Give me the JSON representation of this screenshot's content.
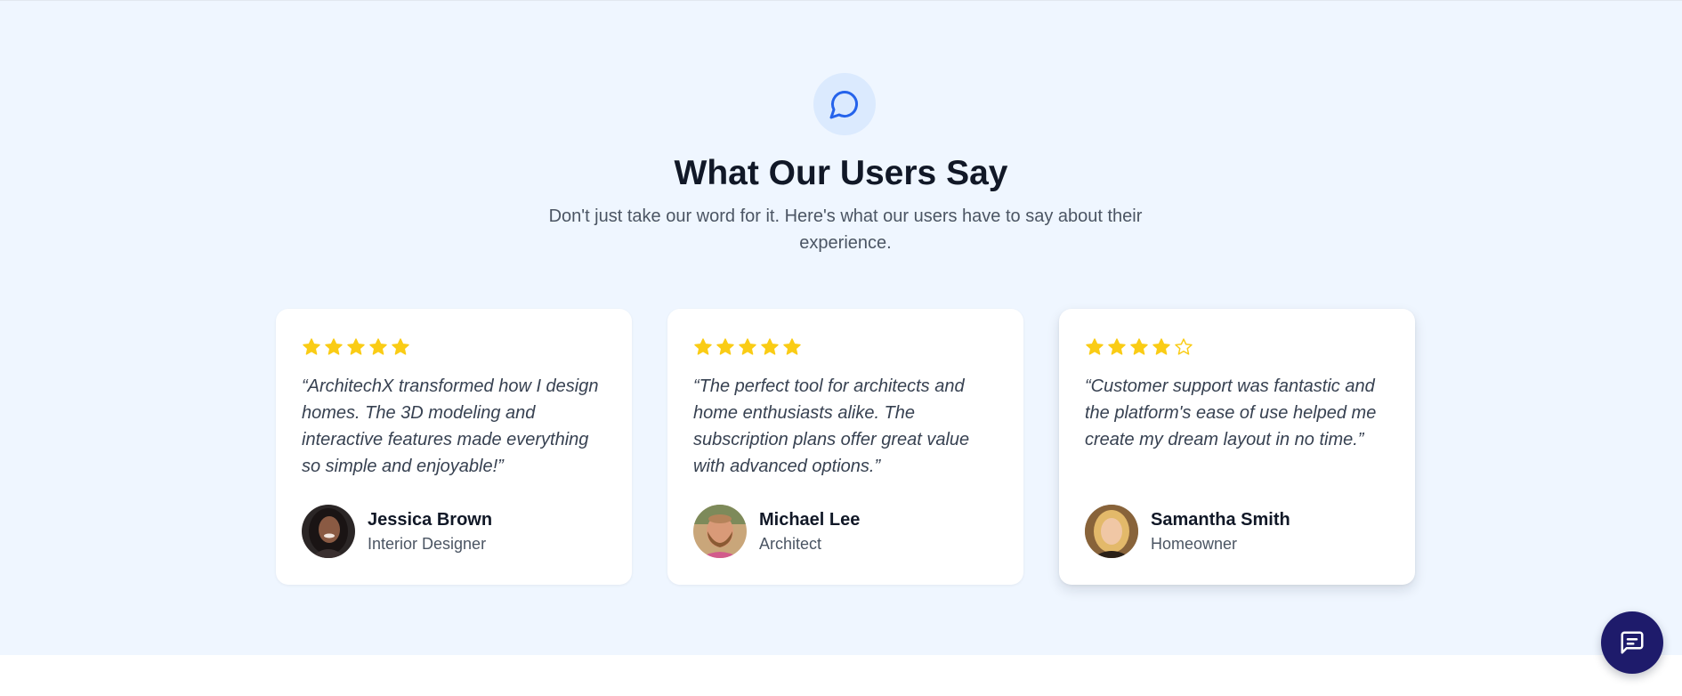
{
  "header": {
    "icon": "chat-bubble-icon",
    "title": "What Our Users Say",
    "subtitle": "Don't just take our word for it. Here's what our users have to say about their experience."
  },
  "colors": {
    "section_bg": "#eff6ff",
    "icon_circle_bg": "#dbeafe",
    "icon_stroke": "#2563eb",
    "star_fill": "#facc15",
    "fab_bg": "#1e1b6b"
  },
  "testimonials": [
    {
      "rating": 5,
      "quote": "“ArchitechX transformed how I design homes. The 3D modeling and interactive features made everything so simple and enjoyable!”",
      "name": "Jessica Brown",
      "role": "Interior Designer",
      "avatar": "avatar-photo"
    },
    {
      "rating": 5,
      "quote": "“The perfect tool for architects and home enthusiasts alike. The subscription plans offer great value with advanced options.”",
      "name": "Michael Lee",
      "role": "Architect",
      "avatar": "avatar-photo"
    },
    {
      "rating": 4,
      "quote": "“Customer support was fantastic and the platform's ease of use helped me create my dream layout in no time.”",
      "name": "Samantha Smith",
      "role": "Homeowner",
      "avatar": "avatar-photo"
    }
  ],
  "chat_button": {
    "icon": "chat-message-icon"
  }
}
